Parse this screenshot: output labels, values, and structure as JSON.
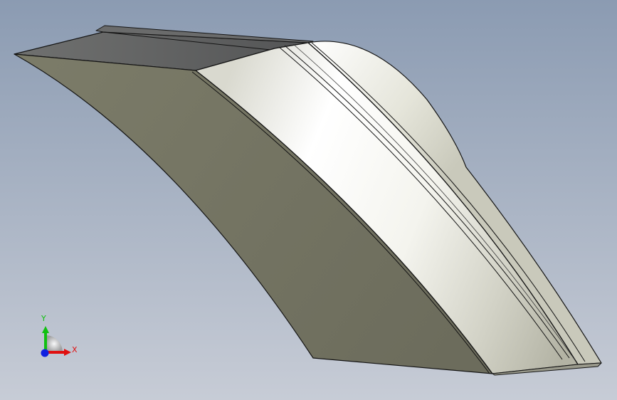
{
  "viewport": {
    "background_top": "#8b9bb2",
    "background_bottom": "#c7ccd6"
  },
  "model": {
    "side_face_color": "#72725f",
    "top_face_color": "#5f6060",
    "curved_face_highlight": "#ffffff",
    "curved_face_shadow": "#b9b9aa",
    "edge_color": "#141414"
  },
  "triad": {
    "x_label": "X",
    "y_label": "Y",
    "x_color": "#e01010",
    "y_color": "#10c010",
    "z_color": "#1020e0"
  }
}
